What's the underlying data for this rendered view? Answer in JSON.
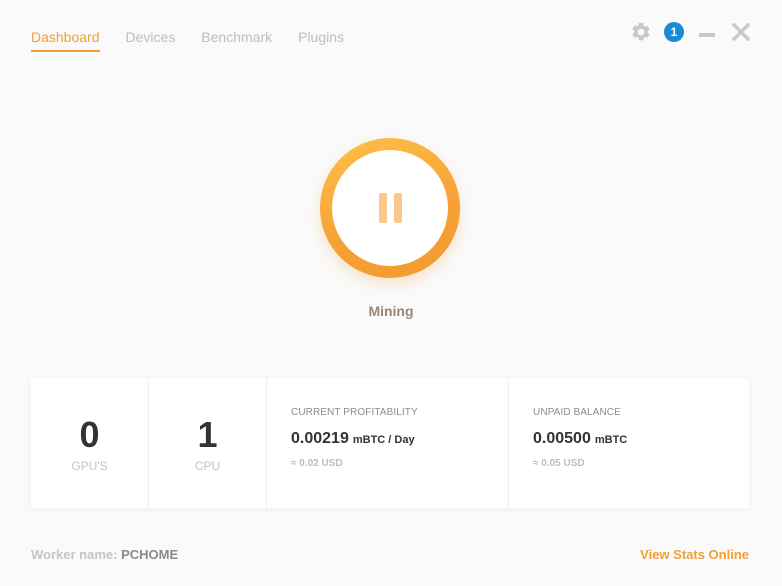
{
  "nav": {
    "tabs": [
      {
        "label": "Dashboard",
        "active": true
      },
      {
        "label": "Devices",
        "active": false
      },
      {
        "label": "Benchmark",
        "active": false
      },
      {
        "label": "Plugins",
        "active": false
      }
    ]
  },
  "controls": {
    "settings_icon": "gear-icon",
    "notification_count": "1",
    "minimize_icon": "minimize-icon",
    "close_icon": "close-icon"
  },
  "mining": {
    "button_icon": "pause-icon",
    "status_label": "Mining"
  },
  "stats": {
    "gpus": {
      "value": "0",
      "label": "GPU'S"
    },
    "cpus": {
      "value": "1",
      "label": "CPU"
    },
    "profitability": {
      "title": "CURRENT PROFITABILITY",
      "value": "0.00219",
      "unit": "mBTC / Day",
      "fiat": "≈ 0.02 USD"
    },
    "balance": {
      "title": "UNPAID BALANCE",
      "value": "0.00500",
      "unit": "mBTC",
      "fiat": "≈ 0.05 USD"
    }
  },
  "footer": {
    "worker_label": "Worker name:",
    "worker_name": "PCHOME",
    "view_stats_label": "View Stats Online"
  },
  "colors": {
    "accent": "#f0a033",
    "badge": "#1c8ad6",
    "background": "#fafafa"
  }
}
